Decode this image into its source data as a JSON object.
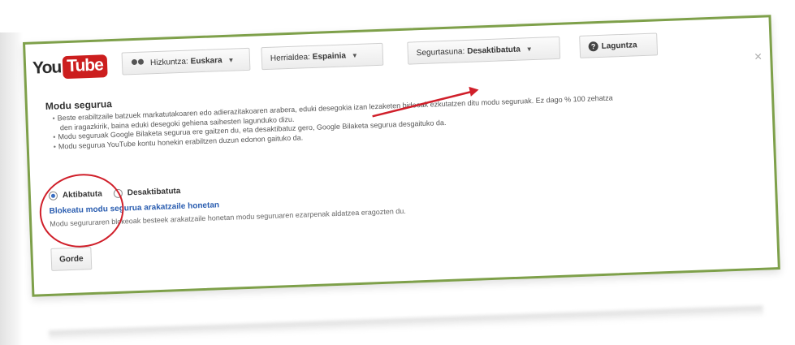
{
  "logo": {
    "you": "You",
    "tube": "Tube"
  },
  "toolbar": {
    "language": {
      "prefix": "Hizkuntza:",
      "value": "Euskara"
    },
    "country": {
      "prefix": "Herrialdea:",
      "value": "Espainia"
    },
    "safety": {
      "prefix": "Segurtasuna:",
      "value": "Desaktibatuta"
    },
    "help": {
      "label": "Laguntza"
    },
    "caret": "▼"
  },
  "close": "×",
  "safety_mode": {
    "title": "Modu segurua",
    "bullets": [
      "Beste erabiltzaile batzuek markatutakoaren edo adierazitakoaren arabera, eduki desegokia izan lezaketen bideoak ezkutatzen ditu modu seguruak. Ez dago % 100 zehatza",
      "den iragazkirik, baina eduki desegoki gehiena saihesten lagunduko dizu.",
      "Modu seguruak Google Bilaketa segurua ere gaitzen du, eta desaktibatuz gero, Google Bilaketa segurua desgaituko da.",
      "Modu segurua YouTube kontu honekin erabiltzen duzun edonon gaituko da."
    ],
    "options": {
      "on": "Aktibatuta",
      "off": "Desaktibatuta"
    },
    "lock_link": "Blokeatu modu segurua arakatzaile honetan",
    "lock_desc": "Modu segururaren blokeoak besteek arakatzaile honetan modu seguruaren ezarpenak aldatzea eragozten du.",
    "save": "Gorde"
  },
  "colors": {
    "frame_border": "#7ea04a",
    "annotation_red": "#d01f2a",
    "link_blue": "#2a5db0",
    "logo_red": "#cc1e1e"
  }
}
